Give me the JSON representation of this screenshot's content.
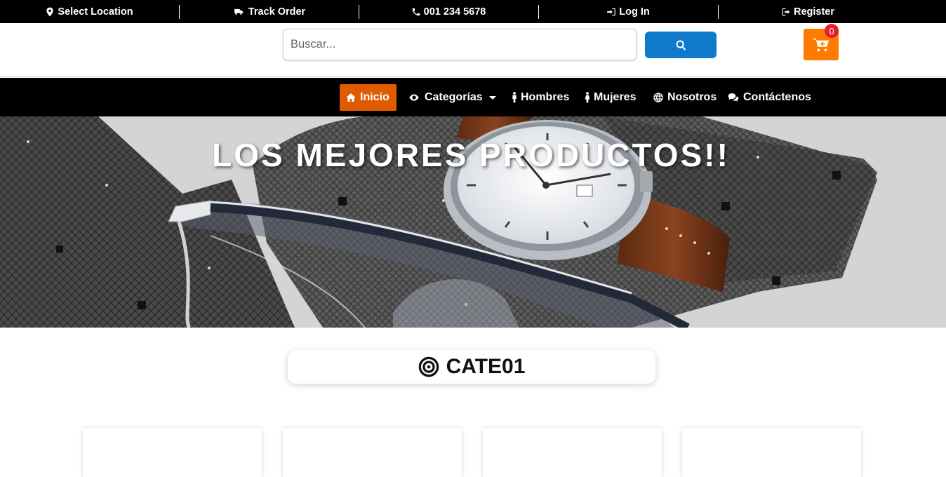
{
  "topbar": {
    "location": "Select Location",
    "track": "Track Order",
    "phone": "001 234 5678",
    "login": "Log In",
    "register": "Register"
  },
  "search": {
    "placeholder": "Buscar..."
  },
  "cart": {
    "count": "0"
  },
  "nav": {
    "inicio": "Inicio",
    "categorias": "Categorías",
    "hombres": "Hombres",
    "mujeres": "Mujeres",
    "nosotros": "Nosotros",
    "contactenos": "Contáctenos"
  },
  "hero": {
    "title": "LOS MEJORES PRODUCTOS!!"
  },
  "category": {
    "title": "CATE01"
  },
  "colors": {
    "topbar": "#000000",
    "search_button": "#0f79cc",
    "cart": "#ff7b00",
    "badge": "#e0202a",
    "nav_active": "#e05a00"
  }
}
